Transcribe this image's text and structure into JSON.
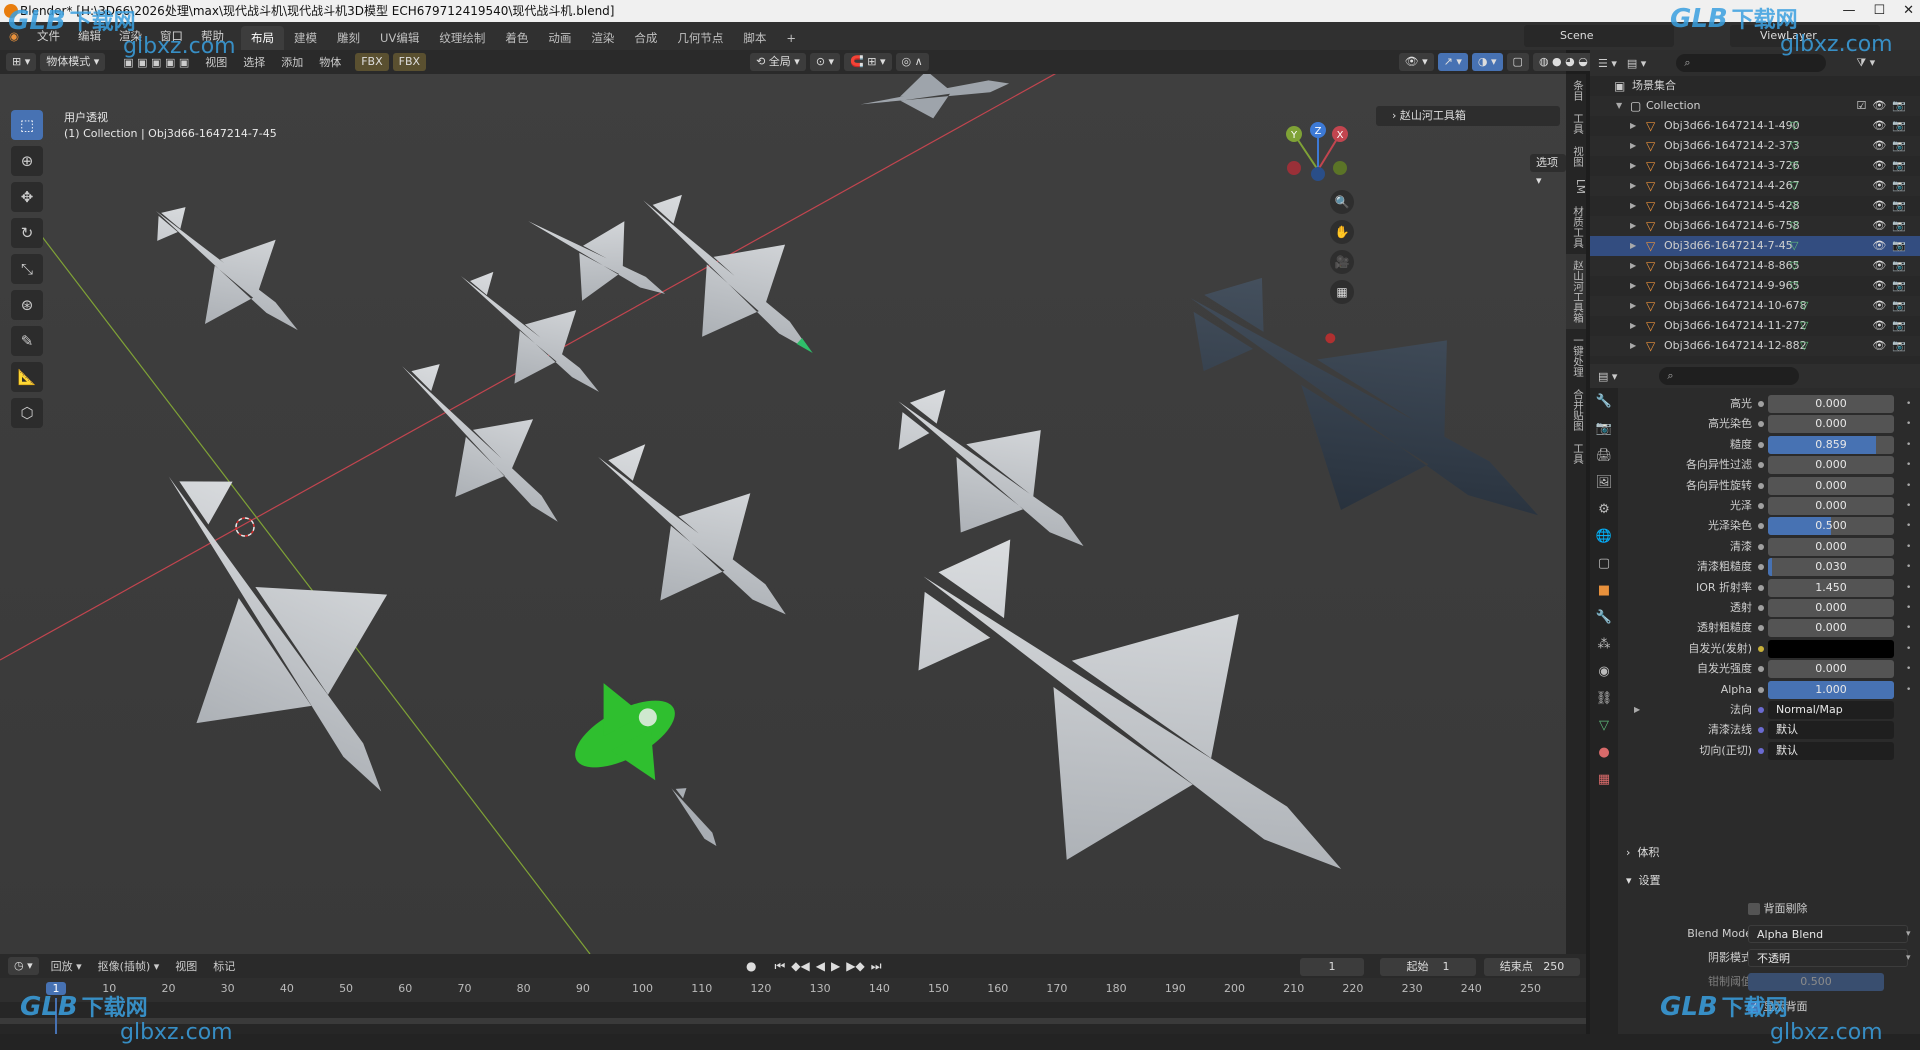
{
  "window": {
    "title": "Blender* [H:\\3D66\\2026处理\\max\\现代战斗机\\现代战斗机3D模型 ECH679712419540\\现代战斗机.blend]"
  },
  "menu": [
    "文件",
    "编辑",
    "渲染",
    "窗口",
    "帮助"
  ],
  "workspaces": [
    {
      "label": "布局",
      "active": true
    },
    {
      "label": "建模"
    },
    {
      "label": "雕刻"
    },
    {
      "label": "UV编辑"
    },
    {
      "label": "纹理绘制"
    },
    {
      "label": "着色"
    },
    {
      "label": "动画"
    },
    {
      "label": "渲染"
    },
    {
      "label": "合成"
    },
    {
      "label": "几何节点"
    },
    {
      "label": "脚本"
    },
    {
      "label": "+"
    }
  ],
  "scene_name": "Scene",
  "view_layer": "ViewLayer",
  "viewport_header": {
    "mode": "物体模式",
    "items": [
      "视图",
      "选择",
      "添加",
      "物体"
    ],
    "transform_orientation": "全局",
    "options": "选项"
  },
  "viewport": {
    "view_name": "用户透视",
    "collection_info": "(1) Collection | Obj3d66-1647214-7-45",
    "toolbox_label": "赵山河工具箱"
  },
  "n_tabs": [
    "条目",
    "工具",
    "视图",
    "LM",
    "材质工具",
    "赵山河工具箱",
    "一键处理",
    "合并贴图",
    "工具"
  ],
  "outliner": {
    "root": "场景集合",
    "collection": "Collection",
    "objects": [
      "Obj3d66-1647214-1-490",
      "Obj3d66-1647214-2-373",
      "Obj3d66-1647214-3-726",
      "Obj3d66-1647214-4-267",
      "Obj3d66-1647214-5-428",
      "Obj3d66-1647214-6-758",
      "Obj3d66-1647214-7-45",
      "Obj3d66-1647214-8-865",
      "Obj3d66-1647214-9-965",
      "Obj3d66-1647214-10-678",
      "Obj3d66-1647214-11-272",
      "Obj3d66-1647214-12-882"
    ]
  },
  "properties": {
    "rows": [
      {
        "label": "高光",
        "value": "0.000",
        "fill": 0
      },
      {
        "label": "高光染色",
        "value": "0.000",
        "fill": 0
      },
      {
        "label": "糙度",
        "value": "0.859",
        "fill": 0.859
      },
      {
        "label": "各向异性过滤",
        "value": "0.000",
        "fill": 0
      },
      {
        "label": "各向异性旋转",
        "value": "0.000",
        "fill": 0
      },
      {
        "label": "光泽",
        "value": "0.000",
        "fill": 0
      },
      {
        "label": "光泽染色",
        "value": "0.500",
        "fill": 0.5
      },
      {
        "label": "清漆",
        "value": "0.000",
        "fill": 0
      },
      {
        "label": "清漆粗糙度",
        "value": "0.030",
        "fill": 0.03
      },
      {
        "label": "IOR 折射率",
        "value": "1.450",
        "fill": 0
      },
      {
        "label": "透射",
        "value": "0.000",
        "fill": 0
      },
      {
        "label": "透射粗糙度",
        "value": "0.000",
        "fill": 0
      },
      {
        "label": "自发光(发射)",
        "value": "",
        "color": "#000000"
      },
      {
        "label": "自发光强度",
        "value": "0.000",
        "fill": 0
      },
      {
        "label": "Alpha",
        "value": "1.000",
        "fill": 1
      },
      {
        "label": "法向",
        "value": "Normal/Map",
        "text": true
      },
      {
        "label": "清漆法线",
        "value": "默认",
        "text": true
      },
      {
        "label": "切向(正切)",
        "value": "默认",
        "text": true
      }
    ],
    "section_volume": "体积",
    "section_settings": "设置",
    "backface_culling": "背面剔除",
    "blend_mode_label": "Blend Mode",
    "blend_mode_value": "Alpha Blend",
    "shadow_mode_label": "阴影模式",
    "shadow_mode_value": "不透明",
    "clip_threshold_label": "钳制阈值",
    "clip_threshold_value": "0.500",
    "show_backface": "显示背面"
  },
  "timeline": {
    "menus": [
      "回放",
      "抠像(插帧)",
      "视图",
      "标记"
    ],
    "current_frame": "1",
    "start_label": "起始",
    "start": "1",
    "end_label": "结束点",
    "end": "250",
    "ruler": [
      "1",
      "10",
      "20",
      "30",
      "40",
      "50",
      "60",
      "70",
      "80",
      "90",
      "100",
      "110",
      "120",
      "130",
      "140",
      "150",
      "160",
      "170",
      "180",
      "190",
      "200",
      "210",
      "220",
      "230",
      "240",
      "250"
    ]
  },
  "watermark": {
    "brand": "GLB",
    "cn": "下载网",
    "url": "glbxz.com"
  },
  "colors": {
    "accent": "#4772b3",
    "x_axis": "#c2454f",
    "y_axis": "#7fa236",
    "z_axis": "#3d7ad6",
    "selected_plane": "#2fbf2f"
  }
}
